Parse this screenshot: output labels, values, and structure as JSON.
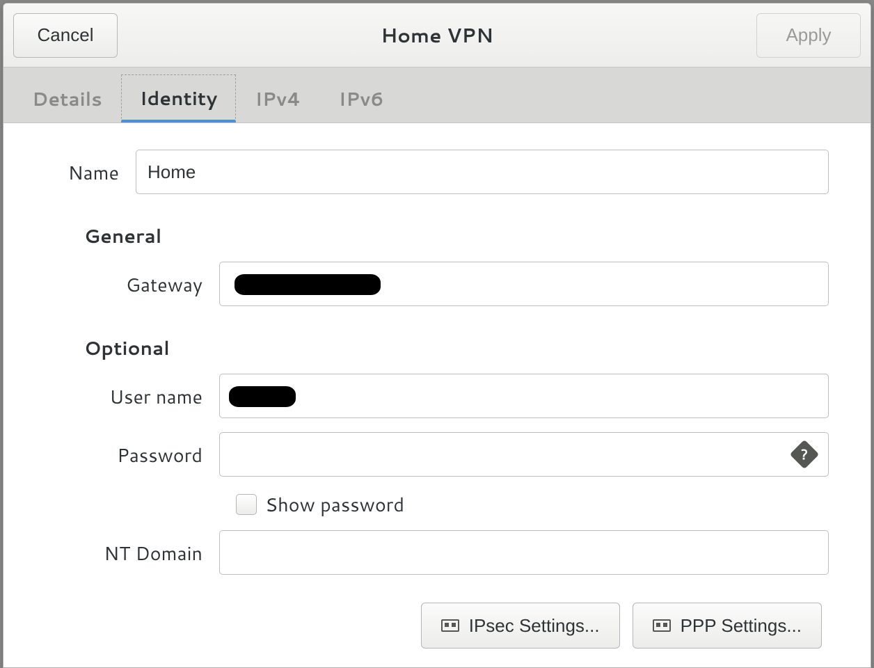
{
  "header": {
    "title": "Home VPN",
    "cancel": "Cancel",
    "apply": "Apply"
  },
  "tabs": {
    "details": "Details",
    "identity": "Identity",
    "ipv4": "IPv4",
    "ipv6": "IPv6"
  },
  "fields": {
    "name_label": "Name",
    "name_value": "Home",
    "general_heading": "General",
    "gateway_label": "Gateway",
    "gateway_value": "",
    "optional_heading": "Optional",
    "username_label": "User name",
    "username_value": "",
    "password_label": "Password",
    "password_value": "",
    "show_password_label": "Show password",
    "ntdomain_label": "NT Domain",
    "ntdomain_value": ""
  },
  "buttons": {
    "ipsec": "IPsec Settings...",
    "ppp": "PPP Settings..."
  }
}
